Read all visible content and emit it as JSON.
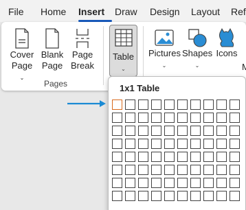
{
  "menu": {
    "tabs": [
      "File",
      "Home",
      "Insert",
      "Draw",
      "Design",
      "Layout",
      "Ref"
    ],
    "active": "Insert"
  },
  "ribbon": {
    "cover_page": [
      "Cover",
      "Page"
    ],
    "blank_page": [
      "Blank",
      "Page"
    ],
    "page_break": [
      "Page",
      "Break"
    ],
    "pages_group": "Pages",
    "table": "Table",
    "pictures": "Pictures",
    "shapes": "Shapes",
    "icons": "Icons",
    "truncated": "M"
  },
  "dropdown": {
    "title": "1x1 Table",
    "rows": 8,
    "cols": 10,
    "selected": [
      1,
      1
    ]
  },
  "colors": {
    "accent": "#185abd",
    "selection": "#d86a1c",
    "arrow": "#1a8ad4"
  }
}
